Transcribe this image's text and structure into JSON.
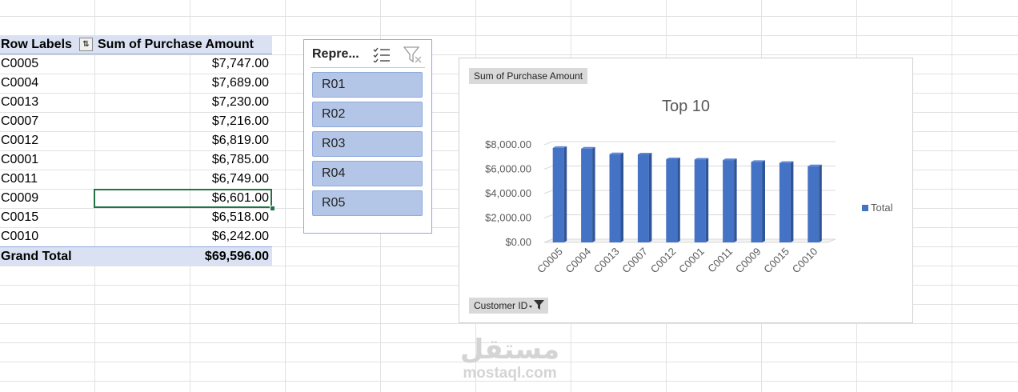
{
  "pivot": {
    "header": {
      "row_labels": "Row Labels",
      "value_header": "Sum of Purchase Amount"
    },
    "rows": [
      {
        "label": "C0005",
        "value": "$7,747.00"
      },
      {
        "label": "C0004",
        "value": "$7,689.00"
      },
      {
        "label": "C0013",
        "value": "$7,230.00"
      },
      {
        "label": "C0007",
        "value": "$7,216.00"
      },
      {
        "label": "C0012",
        "value": "$6,819.00"
      },
      {
        "label": "C0001",
        "value": "$6,785.00"
      },
      {
        "label": "C0011",
        "value": "$6,749.00"
      },
      {
        "label": "C0009",
        "value": "$6,601.00"
      },
      {
        "label": "C0015",
        "value": "$6,518.00"
      },
      {
        "label": "C0010",
        "value": "$6,242.00"
      }
    ],
    "total": {
      "label": "Grand Total",
      "value": "$69,596.00"
    },
    "filter_icon": "filter-sort-icon"
  },
  "slicer": {
    "title": "Repre...",
    "icons": {
      "multi_select": "multi-select-icon",
      "clear_filter": "clear-filter-icon"
    },
    "items": [
      "R01",
      "R02",
      "R03",
      "R04",
      "R05"
    ],
    "item_color": "#b4c6e7"
  },
  "chart": {
    "value_field_button": "Sum of Purchase Amount",
    "axis_field_button": "Customer ID",
    "axis_field_icon": "filter-dropdown-icon",
    "bar_color": "#4472c4"
  },
  "chart_data": {
    "type": "bar",
    "title": "Top 10",
    "categories": [
      "C0005",
      "C0004",
      "C0013",
      "C0007",
      "C0012",
      "C0001",
      "C0011",
      "C0009",
      "C0015",
      "C0010"
    ],
    "series": [
      {
        "name": "Total",
        "values": [
          7747,
          7689,
          7230,
          7216,
          6819,
          6785,
          6749,
          6601,
          6518,
          6242
        ]
      }
    ],
    "ylim": [
      0,
      8000
    ],
    "y_ticks": [
      "$0.00",
      "$2,000.00",
      "$4,000.00",
      "$6,000.00",
      "$8,000.00"
    ],
    "grid": true,
    "legend": "right",
    "style": "3d-column"
  },
  "watermark": {
    "arabic": "مستقل",
    "latin": "mostaql.com"
  }
}
